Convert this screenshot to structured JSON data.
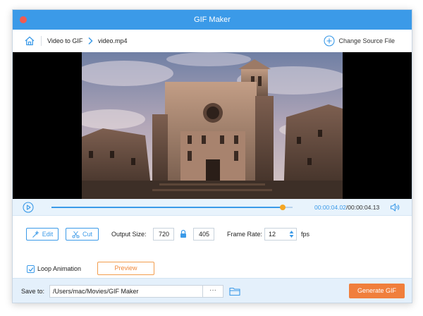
{
  "window": {
    "title": "GIF Maker"
  },
  "nav": {
    "home_icon": "home-icon",
    "breadcrumb_root": "Video to GIF",
    "breadcrumb_file": "video.mp4",
    "change_source_label": "Change Source File"
  },
  "player": {
    "current_time": "00:00:04.02",
    "total_time": "/00:00:04.13",
    "progress_fraction": 0.96
  },
  "controls": {
    "edit_label": "Edit",
    "cut_label": "Cut",
    "output_size_label": "Output Size:",
    "width_value": "720",
    "height_value": "405",
    "frame_rate_label": "Frame Rate:",
    "frame_rate_value": "12",
    "fps_label": "fps",
    "loop_label": "Loop Animation",
    "loop_checked": true,
    "preview_label": "Preview"
  },
  "footer": {
    "save_to_label": "Save to:",
    "save_path": "/Users/mac/Movies/GIF Maker",
    "browse_label": "···",
    "generate_label": "Generate GIF"
  },
  "colors": {
    "accent": "#3b9ae8",
    "progress_knob": "#f5a623",
    "generate_button": "#f07f3c",
    "close_dot": "#f25b52"
  }
}
